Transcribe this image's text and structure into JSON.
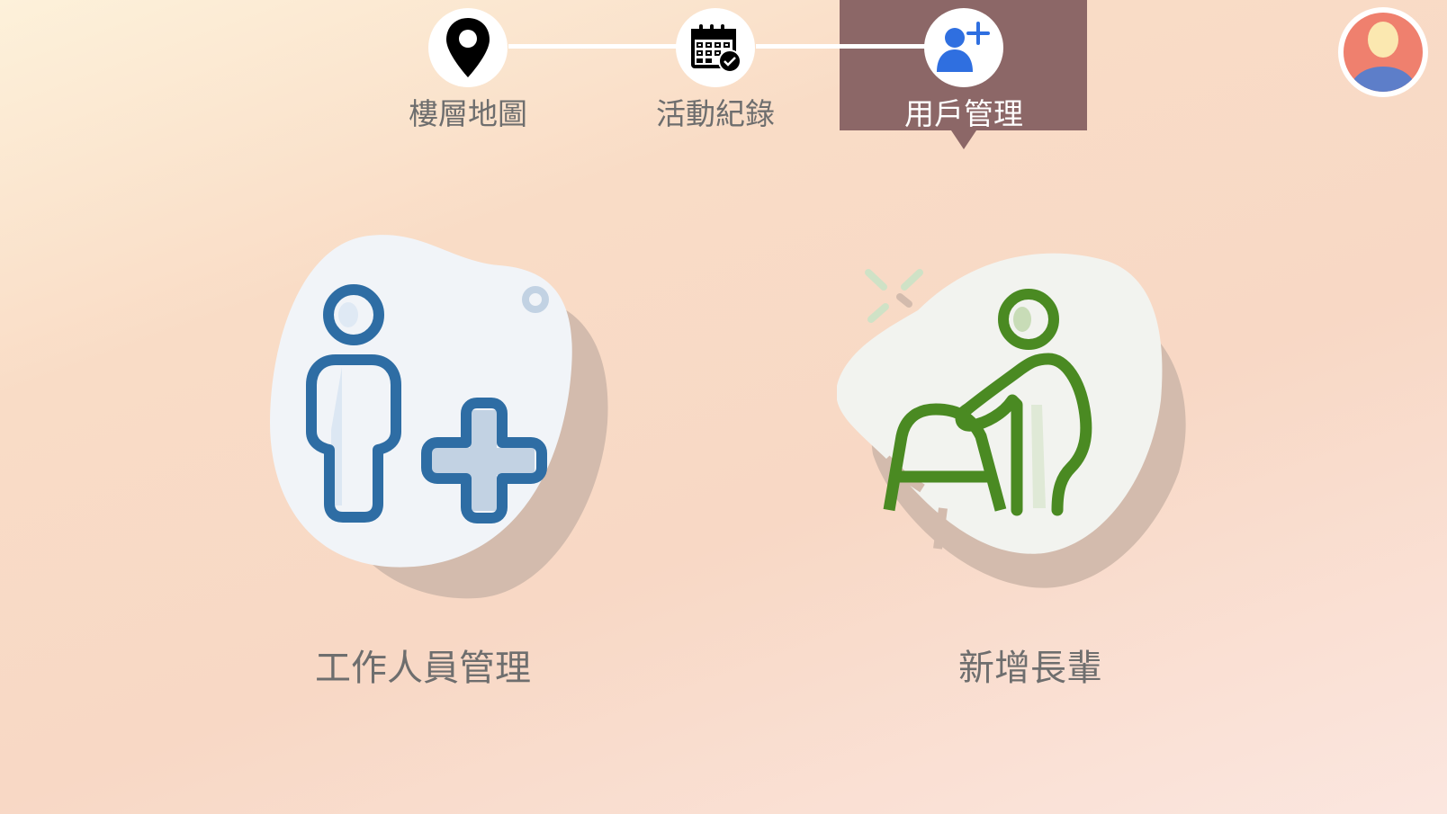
{
  "nav": {
    "steps": [
      {
        "label": "樓層地圖",
        "icon": "location-pin-icon"
      },
      {
        "label": "活動紀錄",
        "icon": "calendar-check-icon"
      },
      {
        "label": "用戶管理",
        "icon": "add-user-icon"
      }
    ],
    "active_index": 2,
    "active_color": "#8c6767"
  },
  "avatar": {
    "icon": "user-avatar-icon"
  },
  "cards": [
    {
      "label": "工作人員管理",
      "icon": "add-staff-icon",
      "accent": "#2e6da4"
    },
    {
      "label": "新增長輩",
      "icon": "elderly-walker-icon",
      "accent": "#4a8a22"
    }
  ],
  "colors": {
    "text": "#6e6e6e",
    "tab_text_active": "#ffffff",
    "connector": "#ffffff"
  }
}
